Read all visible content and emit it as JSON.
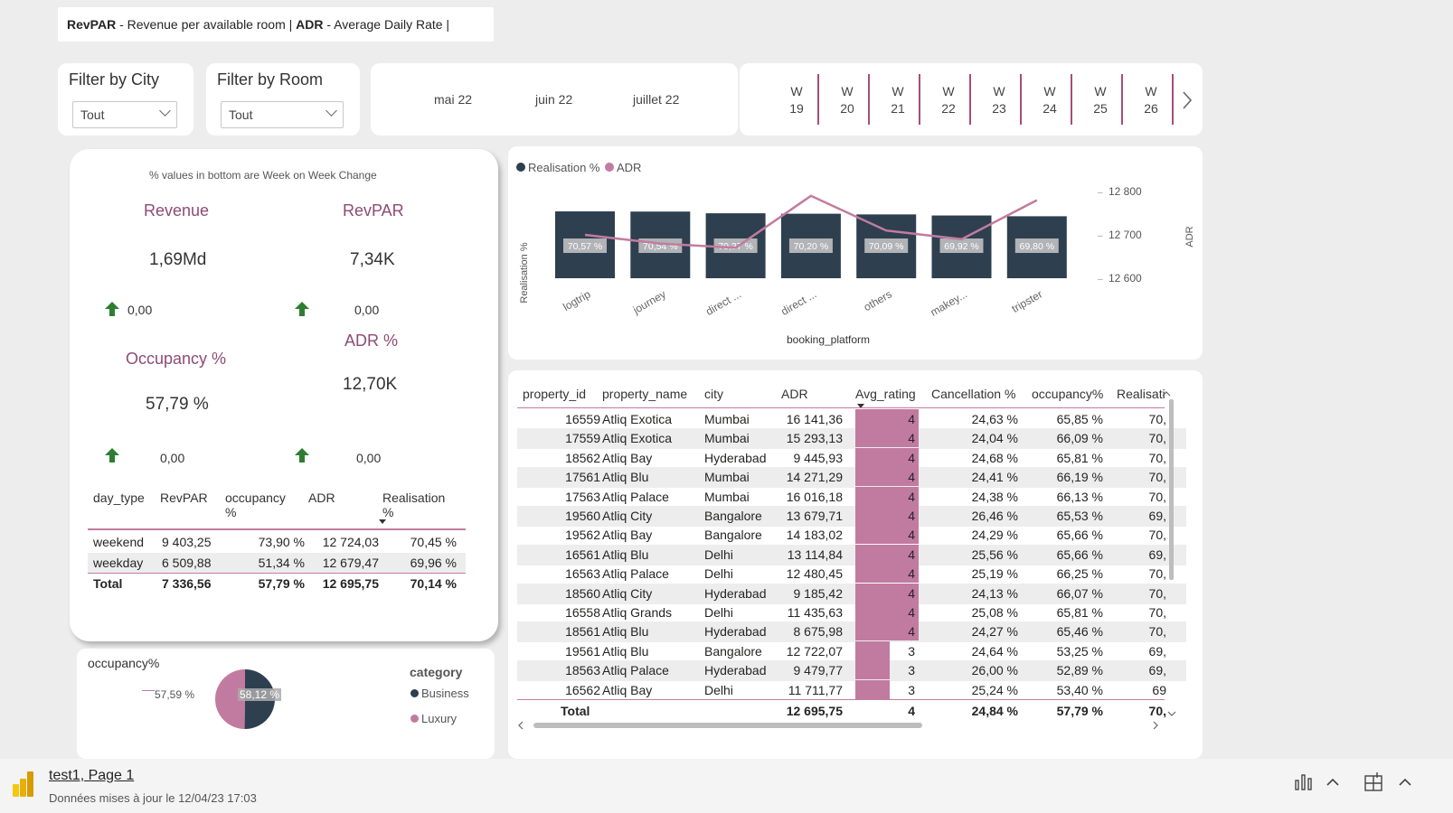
{
  "header": {
    "revpar_abbr": "RevPAR",
    "revpar_desc": " - Revenue per available room | ",
    "adr_abbr": "ADR",
    "adr_desc": " - Average Daily Rate |"
  },
  "filters": {
    "city": {
      "title": "Filter by City",
      "value": "Tout"
    },
    "room": {
      "title": "Filter by Room",
      "value": "Tout"
    }
  },
  "months": [
    "mai 22",
    "juin 22",
    "juillet 22"
  ],
  "weeks": [
    {
      "w": "W",
      "n": "19"
    },
    {
      "w": "W",
      "n": "20"
    },
    {
      "w": "W",
      "n": "21"
    },
    {
      "w": "W",
      "n": "22"
    },
    {
      "w": "W",
      "n": "23"
    },
    {
      "w": "W",
      "n": "24"
    },
    {
      "w": "W",
      "n": "25"
    },
    {
      "w": "W",
      "n": "26"
    }
  ],
  "kpi": {
    "note": "% values in bottom are Week on Week Change",
    "revenue": {
      "title": "Revenue",
      "value": "1,69Md",
      "change": "0,00"
    },
    "revpar": {
      "title": "RevPAR",
      "value": "7,34K",
      "change": "0,00"
    },
    "occupancy": {
      "title": "Occupancy %",
      "value": "57,79 %",
      "change": "0,00"
    },
    "adr": {
      "title": "ADR %",
      "value": "12,70K",
      "change": "0,00"
    },
    "colors": {
      "title": "#8e4a77",
      "arrow": "#2e7d32"
    }
  },
  "day_table": {
    "headers": [
      "day_type",
      "RevPAR",
      "occupancy",
      "%",
      "ADR",
      "Realisation",
      "%"
    ],
    "rows": [
      [
        "weekend",
        "9 403,25",
        "73,90 %",
        "12 724,03",
        "70,45 %"
      ],
      [
        "weekday",
        "6 509,88",
        "51,34 %",
        "12 679,47",
        "69,96 %"
      ]
    ],
    "total": [
      "Total",
      "7 336,56",
      "57,79 %",
      "12 695,75",
      "70,14 %"
    ]
  },
  "pie": {
    "title": "occupancy%",
    "legend_title": "category",
    "legend": [
      {
        "name": "Business",
        "color": "#2e3f4f"
      },
      {
        "name": "Luxury",
        "color": "#c27ba0"
      }
    ],
    "labels": {
      "business": "58,12 %",
      "luxury": "57,59 %"
    },
    "values": {
      "business": 58.12,
      "luxury": 57.59
    }
  },
  "chart_data": {
    "type": "bar",
    "legend": [
      {
        "name": "Realisation %",
        "color": "#2e3f4f"
      },
      {
        "name": "ADR",
        "color": "#c27ba0"
      }
    ],
    "categories": [
      "logtrip",
      "journey",
      "direct ...",
      "direct ...",
      "others",
      "makey...",
      "tripster"
    ],
    "xlabel": "booking_platform",
    "ylabel": "Realisation %",
    "y2label": "ADR",
    "series": [
      {
        "name": "Realisation %",
        "values": [
          70.57,
          70.54,
          70.27,
          70.2,
          70.09,
          69.92,
          69.8
        ],
        "labels": [
          "70,57 %",
          "70,54 %",
          "70,27 %",
          "70,20 %",
          "70,09 %",
          "69,92 %",
          "69,80 %"
        ]
      },
      {
        "name": "ADR",
        "values": [
          12700,
          12680,
          12670,
          12790,
          12710,
          12690,
          12780
        ]
      }
    ],
    "y2_ticks": [
      "12 800",
      "12 700",
      "12 600"
    ],
    "y2lim": [
      12600,
      12800
    ]
  },
  "prop_table": {
    "headers": [
      "property_id",
      "property_name",
      "city",
      "ADR",
      "Avg_rating",
      "Cancellation %",
      "occupancy%",
      "Realisati"
    ],
    "rows": [
      [
        "16559",
        "Atliq Exotica",
        "Mumbai",
        "16 141,36",
        "4",
        "24,63 %",
        "65,85 %",
        "70,"
      ],
      [
        "17559",
        "Atliq Exotica",
        "Mumbai",
        "15 293,13",
        "4",
        "24,04 %",
        "66,09 %",
        "70,"
      ],
      [
        "18562",
        "Atliq Bay",
        "Hyderabad",
        "9 445,93",
        "4",
        "24,68 %",
        "65,81 %",
        "70,"
      ],
      [
        "17561",
        "Atliq Blu",
        "Mumbai",
        "14 271,29",
        "4",
        "24,41 %",
        "66,19 %",
        "70,"
      ],
      [
        "17563",
        "Atliq Palace",
        "Mumbai",
        "16 016,18",
        "4",
        "24,38 %",
        "66,13 %",
        "70,"
      ],
      [
        "19560",
        "Atliq City",
        "Bangalore",
        "13 679,71",
        "4",
        "26,46 %",
        "65,53 %",
        "69,"
      ],
      [
        "19562",
        "Atliq Bay",
        "Bangalore",
        "14 183,02",
        "4",
        "24,29 %",
        "65,66 %",
        "70,"
      ],
      [
        "16561",
        "Atliq Blu",
        "Delhi",
        "13 114,84",
        "4",
        "25,56 %",
        "65,66 %",
        "69,"
      ],
      [
        "16563",
        "Atliq Palace",
        "Delhi",
        "12 480,45",
        "4",
        "25,19 %",
        "66,25 %",
        "70,"
      ],
      [
        "18560",
        "Atliq City",
        "Hyderabad",
        "9 185,42",
        "4",
        "24,13 %",
        "66,07 %",
        "70,"
      ],
      [
        "16558",
        "Atliq Grands",
        "Delhi",
        "11 435,63",
        "4",
        "25,08 %",
        "65,81 %",
        "70,"
      ],
      [
        "18561",
        "Atliq Blu",
        "Hyderabad",
        "8 675,98",
        "4",
        "24,27 %",
        "65,46 %",
        "70,"
      ],
      [
        "19561",
        "Atliq Blu",
        "Bangalore",
        "12 722,07",
        "3",
        "24,64 %",
        "53,25 %",
        "69,"
      ],
      [
        "18563",
        "Atliq Palace",
        "Hyderabad",
        "9 479,77",
        "3",
        "26,00 %",
        "52,89 %",
        "69,"
      ],
      [
        "16562",
        "Atliq Bay",
        "Delhi",
        "11 711,77",
        "3",
        "25,24 %",
        "53,40 %",
        "69"
      ]
    ],
    "ratings": [
      4,
      4,
      4,
      4,
      4,
      4,
      4,
      4,
      4,
      4,
      4,
      4,
      3,
      3,
      3
    ],
    "total": [
      "Total",
      "",
      "",
      "12 695,75",
      "4",
      "24,84 %",
      "57,79 %",
      "70,"
    ],
    "bar_color": "#c27ba0"
  },
  "footer": {
    "page_link": "test1, Page 1",
    "updated": "Données mises à jour le 12/04/23 17:03"
  }
}
